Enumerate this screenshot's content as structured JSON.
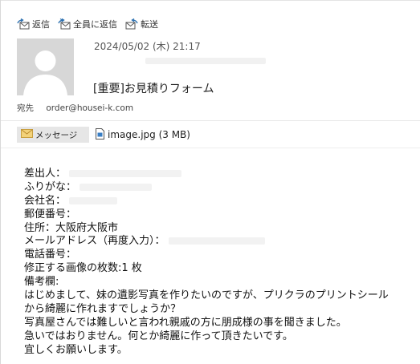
{
  "toolbar": {
    "reply": "返信",
    "reply_all": "全員に返信",
    "forward": "転送"
  },
  "header": {
    "date": "2024/05/02 (木) 21:17",
    "subject": "[重要]お見積りフォーム",
    "to_label": "宛先",
    "to_address": "order@housei-k.com"
  },
  "attachments": {
    "message_tab": "メッセージ",
    "file_name": "image.jpg (3 MB)"
  },
  "body": {
    "lines": [
      "差出人：",
      "ふりがな：",
      "会社名：",
      "郵便番号：",
      "住所：大阪府大阪市",
      "メールアドレス（再度入力）：",
      "電話番号：",
      "修正する画像の枚数:1 枚",
      "備考欄:",
      "はじめまして、妹の遺影写真を作りたいのですが、プリクラのプリントシール",
      "から綺麗に作れますでしょうか？",
      "写真屋さんでは難しいと言われ親戚の方に朋成様の事を聞きました。",
      "急いではおりません。何とか綺麗に作って頂きたいです。",
      "宜しくお願いします。"
    ]
  },
  "colors": {
    "accent": "#2a6fb0",
    "avatar_bg": "#d7d7d7",
    "tab_bg": "#e6e6e6"
  },
  "icons": {
    "reply": "reply-icon",
    "reply_all": "reply-all-icon",
    "forward": "forward-icon",
    "avatar": "avatar-silhouette",
    "message": "envelope-icon",
    "file": "image-file-icon"
  }
}
